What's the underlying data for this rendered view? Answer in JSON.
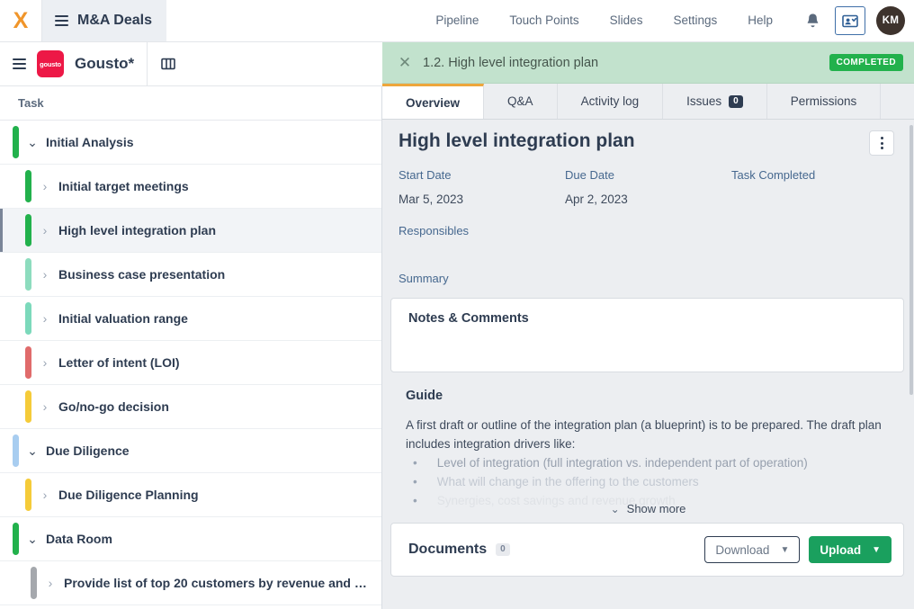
{
  "topbar": {
    "logo_text": "X",
    "deals_label": "M&A Deals",
    "nav": [
      {
        "label": "Pipeline"
      },
      {
        "label": "Touch Points"
      },
      {
        "label": "Slides"
      },
      {
        "label": "Settings"
      },
      {
        "label": "Help"
      }
    ],
    "bell_icon": "bell-icon",
    "screenshare_icon": "presentation-user-icon",
    "avatar_initials": "KM"
  },
  "subbar": {
    "company_logo_text": "gousto",
    "company_name": "Gousto*",
    "panel_toggle_icon": "panel-layout-icon"
  },
  "tasklist": {
    "column_header": "Task",
    "rows": [
      {
        "label": "Initial Analysis",
        "color": "#22b14c",
        "type": "group",
        "expanded": true,
        "selected": false
      },
      {
        "label": "Initial target meetings",
        "color": "#22b14c",
        "type": "task",
        "expanded": false,
        "selected": false
      },
      {
        "label": "High level integration plan",
        "color": "#22b14c",
        "type": "task",
        "expanded": false,
        "selected": true
      },
      {
        "label": "Business case presentation",
        "color": "#8ddcbe",
        "type": "task",
        "expanded": false,
        "selected": false
      },
      {
        "label": "Initial valuation range",
        "color": "#7cd9bb",
        "type": "task",
        "expanded": false,
        "selected": false
      },
      {
        "label": "Letter of intent (LOI)",
        "color": "#e06b6b",
        "type": "task",
        "expanded": false,
        "selected": false
      },
      {
        "label": "Go/no-go decision",
        "color": "#f5cb39",
        "type": "task",
        "expanded": false,
        "selected": false
      },
      {
        "label": "Due Diligence",
        "color": "#a8cdf0",
        "type": "group",
        "expanded": true,
        "selected": false
      },
      {
        "label": "Due Diligence Planning",
        "color": "#f5cb39",
        "type": "task",
        "expanded": false,
        "selected": false
      },
      {
        "label": "Data Room",
        "color": "#22b14c",
        "type": "group",
        "expanded": true,
        "selected": false
      },
      {
        "label": "Provide list of top 20 customers by revenue and …",
        "color": "#a5a8ad",
        "type": "subtask",
        "expanded": false,
        "selected": false
      }
    ]
  },
  "detail": {
    "close_icon": "close-icon",
    "header_title": "1.2. High level integration plan",
    "status_badge": "COMPLETED",
    "status_color": "#22b14c",
    "tabs": [
      {
        "label": "Overview",
        "active": true,
        "badge": null
      },
      {
        "label": "Q&A",
        "active": false,
        "badge": null
      },
      {
        "label": "Activity log",
        "active": false,
        "badge": null
      },
      {
        "label": "Issues",
        "active": false,
        "badge": "0"
      },
      {
        "label": "Permissions",
        "active": false,
        "badge": null
      }
    ],
    "title": "High level integration plan",
    "kebab_icon": "more-vertical-icon",
    "fields": {
      "start_date_label": "Start Date",
      "start_date_value": "Mar 5, 2023",
      "due_date_label": "Due Date",
      "due_date_value": "Apr 2, 2023",
      "task_completed_label": "Task Completed",
      "responsibles_label": "Responsibles",
      "summary_label": "Summary"
    },
    "notes": {
      "title": "Notes & Comments"
    },
    "guide": {
      "title": "Guide",
      "paragraph": "A first draft or outline of the integration plan (a blueprint) is to be prepared. The draft plan includes integration drivers like:",
      "bullets": [
        "Level of integration (full integration vs. independent part of operation)",
        "What will change in the offering to the customers",
        "Synergies, cost savings and revenue growth"
      ],
      "show_more_label": "Show more",
      "show_more_icon": "chevron-double-down-icon"
    },
    "documents": {
      "title": "Documents",
      "count": "0",
      "download_label": "Download",
      "upload_label": "Upload",
      "caret_icon": "chevron-down-icon",
      "upload_color": "#1aa05e"
    }
  }
}
